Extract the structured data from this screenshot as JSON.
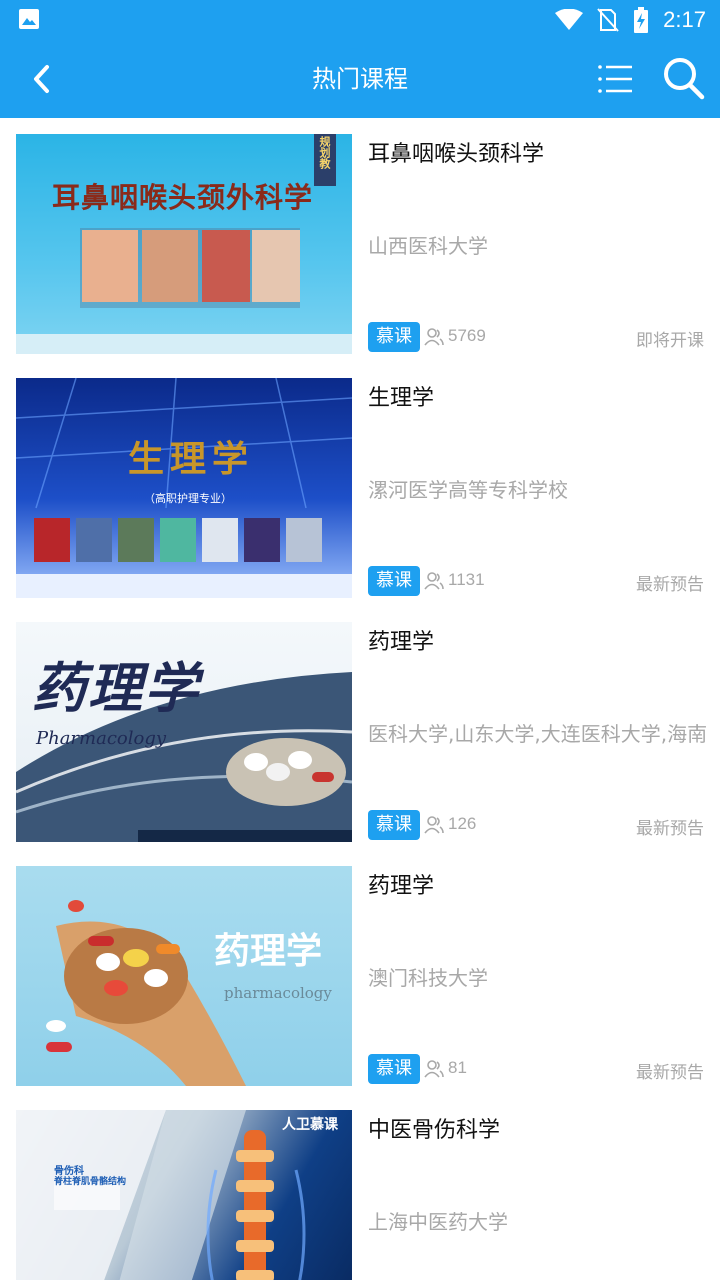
{
  "status_bar": {
    "time": "2:17"
  },
  "header": {
    "title": "热门课程"
  },
  "courses": [
    {
      "title": "耳鼻咽喉头颈科学",
      "school": "山西医科大学",
      "tag": "慕课",
      "count": "5769",
      "status": "即将开课",
      "thumb_title": "耳鼻咽喉头颈外科学",
      "thumb_badge": "规划教"
    },
    {
      "title": "生理学",
      "school": "漯河医学高等专科学校",
      "tag": "慕课",
      "count": "1131",
      "status": "最新预告",
      "thumb_title": "生理学",
      "thumb_subtitle": "（高职护理专业）"
    },
    {
      "title": "药理学",
      "school": "医科大学,山东大学,大连医科大学,海南",
      "tag": "慕课",
      "count": "126",
      "status": "最新预告",
      "thumb_title": "药理学",
      "thumb_subtitle": "Pharmacology"
    },
    {
      "title": "药理学",
      "school": "澳门科技大学",
      "tag": "慕课",
      "count": "81",
      "status": "最新预告",
      "thumb_title": "药理学",
      "thumb_subtitle": "pharmacology"
    },
    {
      "title": "中医骨伤科学",
      "school": "上海中医药大学",
      "thumb_logo": "人卫慕课",
      "thumb_small": "骨伤科",
      "thumb_small2": "脊柱脊肌骨骼结构"
    }
  ],
  "colors": {
    "accent": "#1ea0f0",
    "muted_text": "#a8a8a8"
  }
}
